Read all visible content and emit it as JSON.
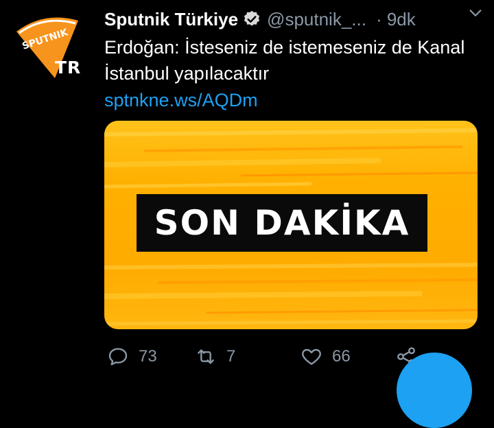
{
  "tweet": {
    "author_name": "Sputnik Türkiye",
    "handle": "@sputnik_...",
    "time": "· 9dk",
    "text": "Erdoğan: İsteseniz de istemeseniz de Kanal İstanbul yapılacaktır",
    "link": "sptnkne.ws/AQDm"
  },
  "avatar": {
    "logo_text": "SPUTNIK",
    "sub_text": "TR"
  },
  "card": {
    "banner_text": "SON DAKİKA"
  },
  "actions": {
    "reply_count": "73",
    "retweet_count": "7",
    "like_count": "66"
  },
  "colors": {
    "background": "#000000",
    "link": "#1da1f2",
    "muted": "#8b98a5",
    "card_orange": "#ffab00",
    "logo_orange": "#f7941d"
  },
  "icons": {
    "verified": "verified-badge-icon",
    "menu": "chevron-down-icon",
    "reply": "reply-icon",
    "retweet": "retweet-icon",
    "like": "heart-icon",
    "share": "share-icon"
  }
}
